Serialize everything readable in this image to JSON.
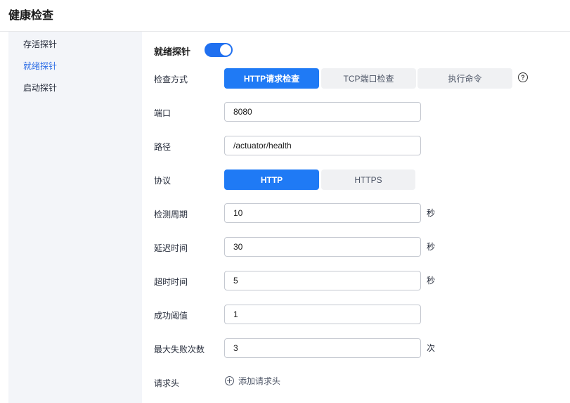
{
  "page": {
    "title": "健康检查"
  },
  "sidebar": {
    "items": [
      {
        "label": "存活探针",
        "active": false
      },
      {
        "label": "就绪探针",
        "active": true
      },
      {
        "label": "启动探针",
        "active": false
      }
    ]
  },
  "form": {
    "section_title": "就绪探针",
    "toggle_on": true,
    "check_method": {
      "label": "检查方式",
      "options": [
        "HTTP请求检查",
        "TCP端口检查",
        "执行命令"
      ],
      "selected": "HTTP请求检查",
      "help_icon": "question-circle-icon"
    },
    "port": {
      "label": "端口",
      "value": "8080"
    },
    "path": {
      "label": "路径",
      "value": "/actuator/health"
    },
    "protocol": {
      "label": "协议",
      "options": [
        "HTTP",
        "HTTPS"
      ],
      "selected": "HTTP"
    },
    "period": {
      "label": "检测周期",
      "value": "10",
      "unit": "秒"
    },
    "delay": {
      "label": "延迟时间",
      "value": "30",
      "unit": "秒"
    },
    "timeout": {
      "label": "超时时间",
      "value": "5",
      "unit": "秒"
    },
    "success_threshold": {
      "label": "成功阈值",
      "value": "1"
    },
    "failure_threshold": {
      "label": "最大失败次数",
      "value": "3",
      "unit": "次"
    },
    "headers": {
      "label": "请求头",
      "add_label": "添加请求头",
      "add_icon": "plus-circle-icon"
    }
  },
  "colors": {
    "accent": "#1f7af5",
    "sidebar_bg": "#f3f5f9",
    "active_nav": "#2e6ee6"
  }
}
